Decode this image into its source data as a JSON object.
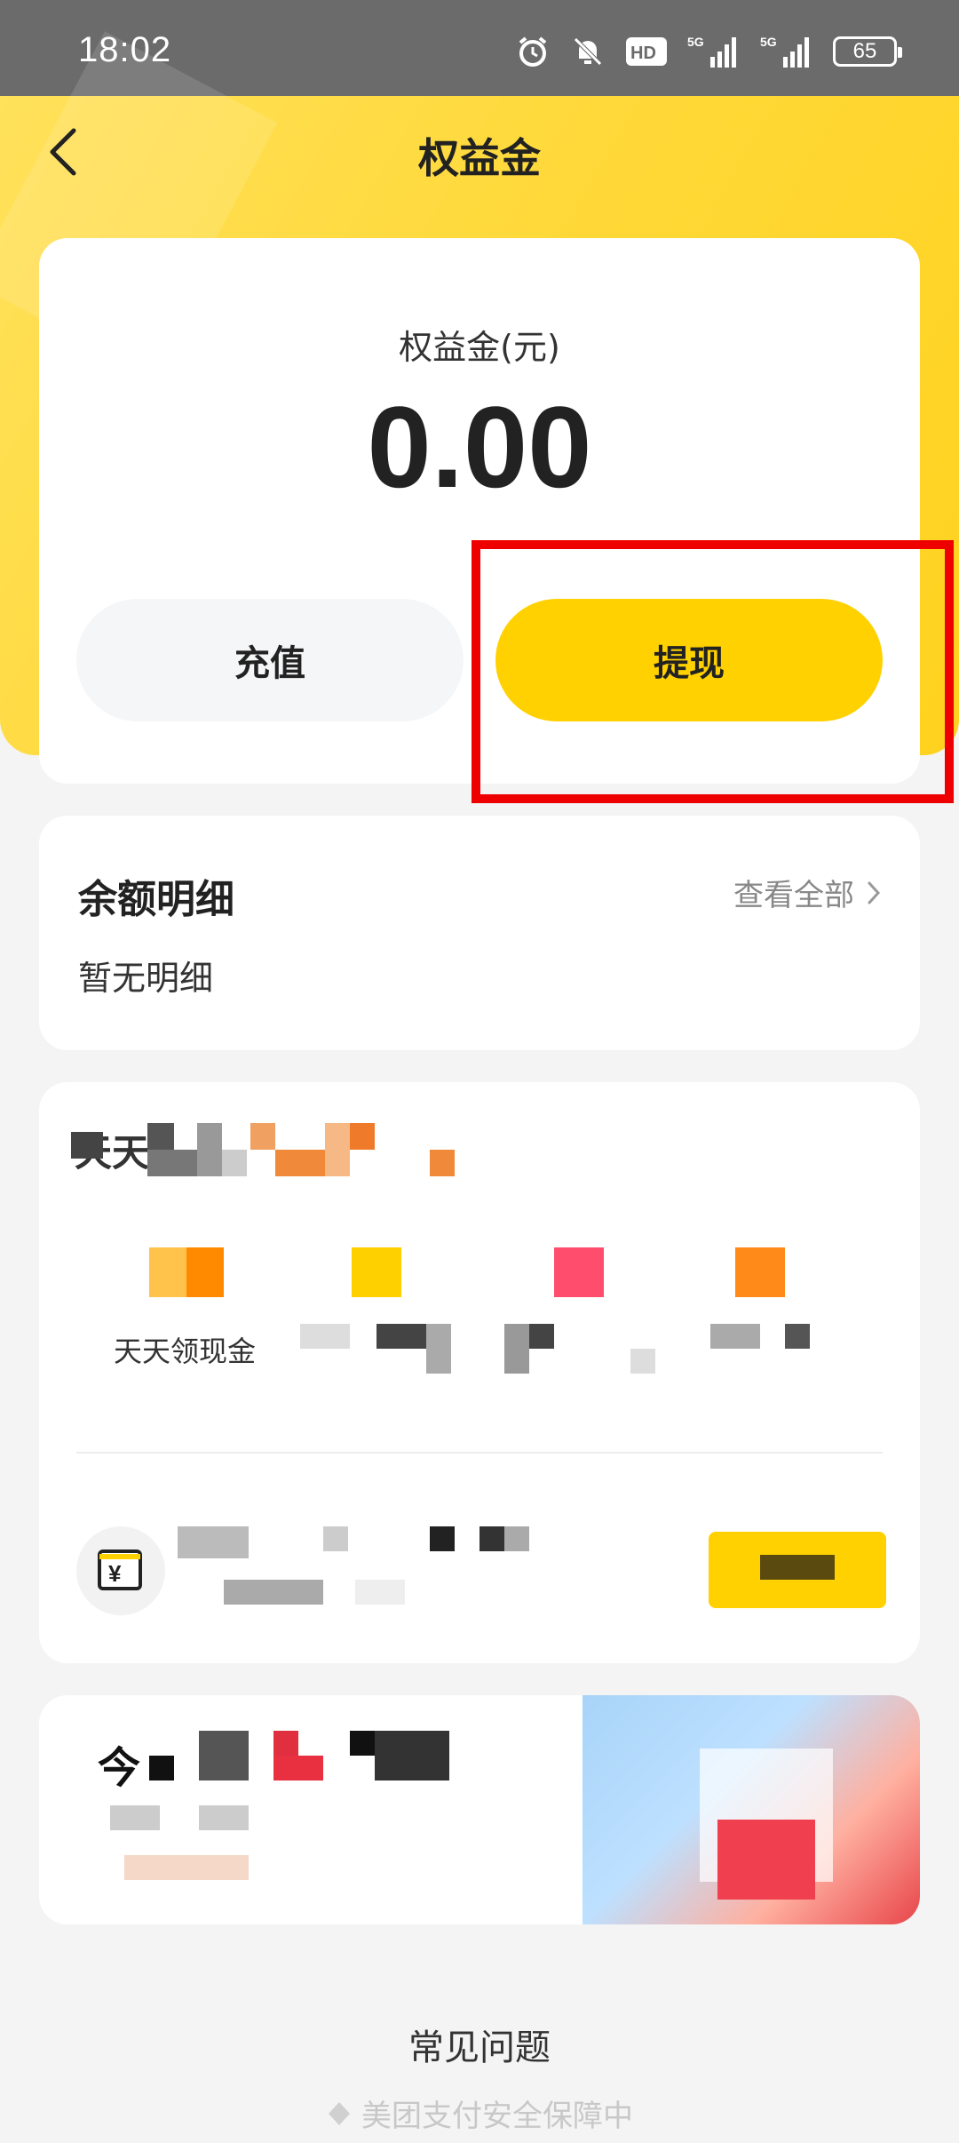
{
  "status_bar": {
    "time": "18:02",
    "network_badge": "HD",
    "signal_1_label": "5G",
    "signal_2_label": "5G",
    "battery": "65",
    "icons": [
      "alarm-icon",
      "mute-icon",
      "hd-icon",
      "signal-icon",
      "signal-icon",
      "battery-icon"
    ]
  },
  "nav": {
    "title": "权益金",
    "back_icon": "back-chevron-icon"
  },
  "balance": {
    "label": "权益金(元)",
    "value": "0.00",
    "recharge_label": "充值",
    "withdraw_label": "提现"
  },
  "details": {
    "title": "余额明细",
    "view_all": "查看全部",
    "empty": "暂无明细"
  },
  "tasks": {
    "section_title": "天天",
    "items": [
      {
        "label": "天天领现金"
      }
    ]
  },
  "promo": {
    "title": "今"
  },
  "footer": {
    "faq": "常见问题",
    "security": "美团支付安全保障中"
  },
  "colors": {
    "accent_yellow": "#ffd100",
    "highlight_red": "#ee0000",
    "header_yellow": "#ffd93a"
  }
}
